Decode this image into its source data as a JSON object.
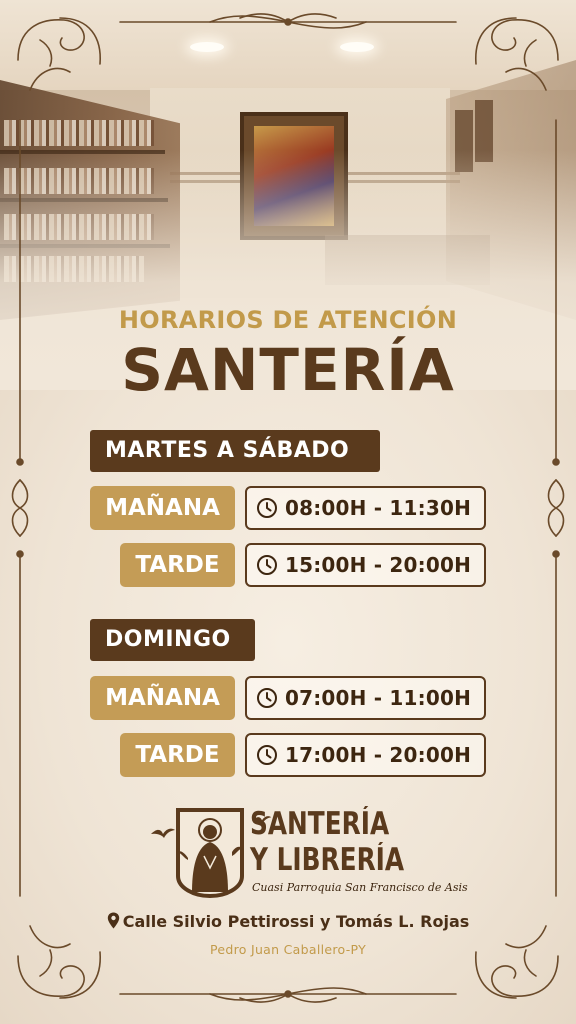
{
  "header": {
    "subtitle": "HORARIOS DE ATENCIÓN",
    "title": "SANTERÍA"
  },
  "schedule": [
    {
      "day": "MARTES A SÁBADO",
      "slots": [
        {
          "period": "MAÑANA",
          "time": "08:00H - 11:30H"
        },
        {
          "period": "TARDE",
          "time": "15:00H - 20:00H"
        }
      ]
    },
    {
      "day": "DOMINGO",
      "slots": [
        {
          "period": "MAÑANA",
          "time": "07:00H - 11:00H"
        },
        {
          "period": "TARDE",
          "time": "17:00H - 20:00H"
        }
      ]
    }
  ],
  "logo": {
    "line1": "SANTERÍA",
    "line2": "Y LIBRERÍA",
    "tagline": "Cuasi Parroquia San Francisco de Asis"
  },
  "footer": {
    "address": "Calle Silvio Pettirossi y Tomás L. Rojas",
    "city": "Pedro Juan Caballero-PY"
  },
  "icons": {
    "clock": "clock-icon",
    "pin": "location-pin-icon"
  },
  "colors": {
    "dark_brown": "#5a3a1d",
    "gold": "#c49c56",
    "title_gold": "#c29a4a",
    "background": "#f1e7d9"
  }
}
